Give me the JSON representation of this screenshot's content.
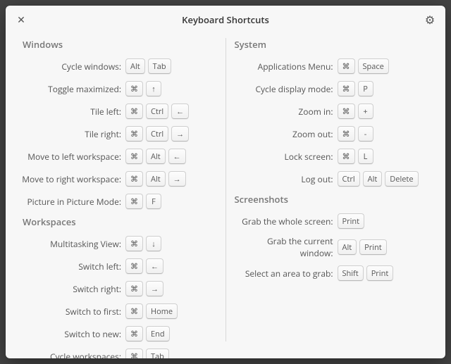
{
  "title": "Keyboard Shortcuts",
  "icons": {
    "close": "✕",
    "gear": "⚙",
    "cmd": "⌘",
    "up": "↑",
    "down": "↓",
    "left": "←",
    "right": "→"
  },
  "left": {
    "windows": {
      "title": "Windows",
      "rows": [
        {
          "label": "Cycle windows:",
          "keys": [
            "Alt",
            "Tab"
          ]
        },
        {
          "label": "Toggle maximized:",
          "keys": [
            "cmd",
            "up"
          ]
        },
        {
          "label": "Tile left:",
          "keys": [
            "cmd",
            "Ctrl",
            "left"
          ]
        },
        {
          "label": "Tile right:",
          "keys": [
            "cmd",
            "Ctrl",
            "right"
          ]
        },
        {
          "label": "Move to left workspace:",
          "keys": [
            "cmd",
            "Alt",
            "left"
          ]
        },
        {
          "label": "Move to right workspace:",
          "keys": [
            "cmd",
            "Alt",
            "right"
          ]
        },
        {
          "label": "Picture in Picture Mode:",
          "keys": [
            "cmd",
            "F"
          ]
        }
      ]
    },
    "workspaces": {
      "title": "Workspaces",
      "rows": [
        {
          "label": "Multitasking View:",
          "keys": [
            "cmd",
            "down"
          ]
        },
        {
          "label": "Switch left:",
          "keys": [
            "cmd",
            "left"
          ]
        },
        {
          "label": "Switch right:",
          "keys": [
            "cmd",
            "right"
          ]
        },
        {
          "label": "Switch to first:",
          "keys": [
            "cmd",
            "Home"
          ]
        },
        {
          "label": "Switch to new:",
          "keys": [
            "cmd",
            "End"
          ]
        },
        {
          "label": "Cycle workspaces:",
          "keys": [
            "cmd",
            "Tab"
          ]
        }
      ]
    }
  },
  "right": {
    "system": {
      "title": "System",
      "rows": [
        {
          "label": "Applications Menu:",
          "keys": [
            "cmd",
            "Space"
          ]
        },
        {
          "label": "Cycle display mode:",
          "keys": [
            "cmd",
            "P"
          ]
        },
        {
          "label": "Zoom in:",
          "keys": [
            "cmd",
            "+"
          ]
        },
        {
          "label": "Zoom out:",
          "keys": [
            "cmd",
            "-"
          ]
        },
        {
          "label": "Lock screen:",
          "keys": [
            "cmd",
            "L"
          ]
        },
        {
          "label": "Log out:",
          "keys": [
            "Ctrl",
            "Alt",
            "Delete"
          ]
        }
      ]
    },
    "screenshots": {
      "title": "Screenshots",
      "rows": [
        {
          "label": "Grab the whole screen:",
          "keys": [
            "Print"
          ]
        },
        {
          "label": "Grab the current window:",
          "keys": [
            "Alt",
            "Print"
          ]
        },
        {
          "label": "Select an area to grab:",
          "keys": [
            "Shift",
            "Print"
          ]
        }
      ]
    }
  }
}
